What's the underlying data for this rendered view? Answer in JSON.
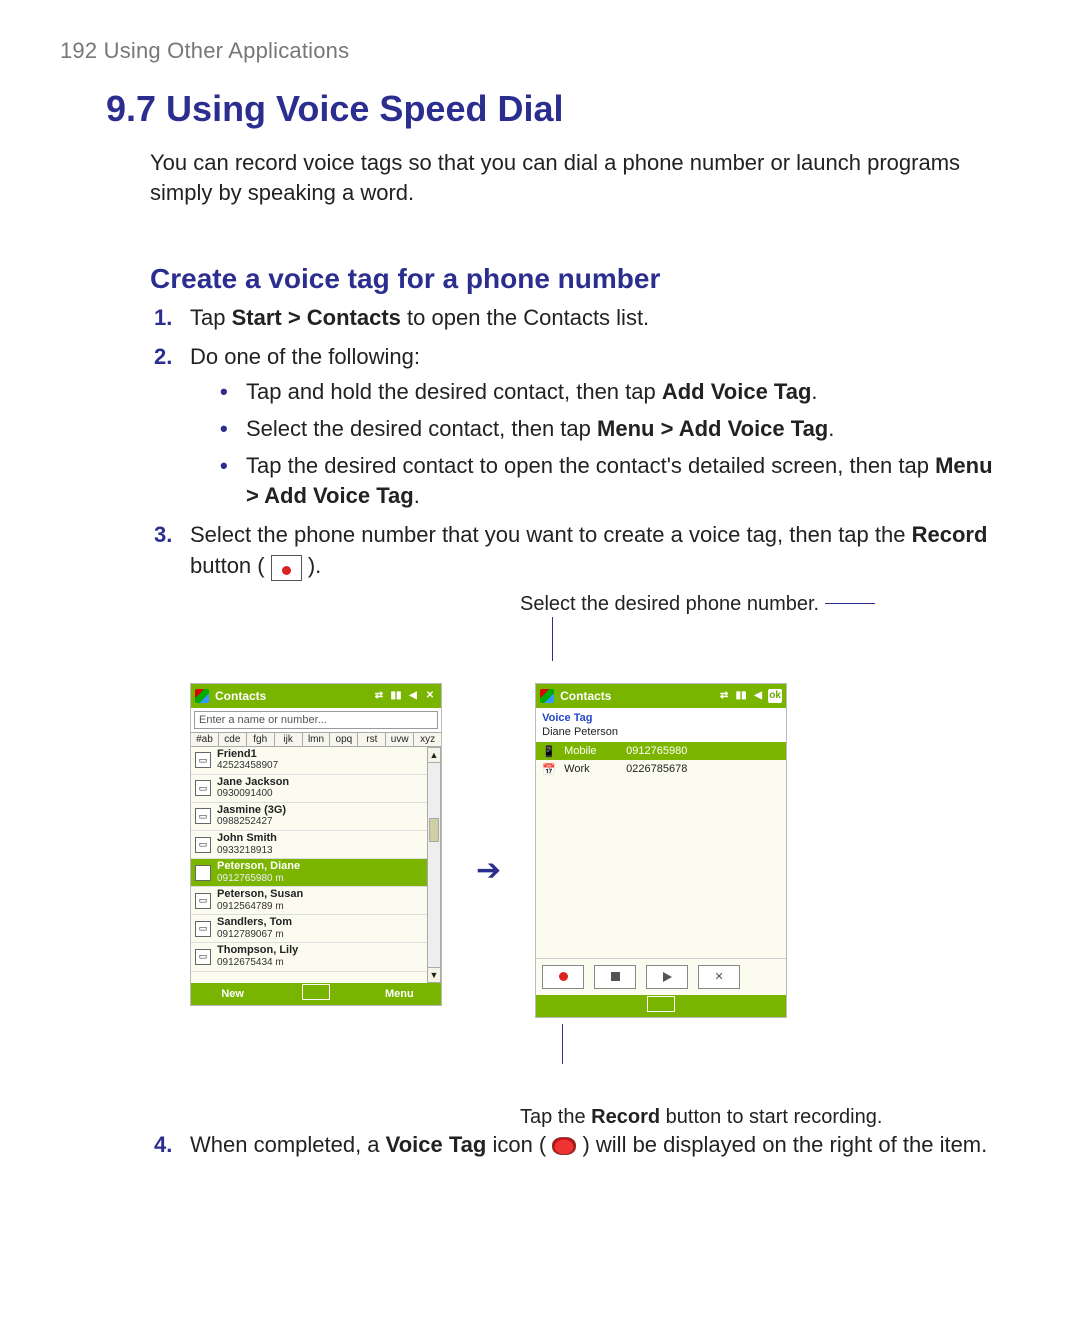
{
  "runhead": "192  Using Other Applications",
  "h1": "9.7 Using Voice Speed Dial",
  "intro": "You can record voice tags so that you can dial a phone number or launch programs simply by speaking a word.",
  "h2": "Create a voice tag for a phone number",
  "steps": {
    "s1_a": "Tap ",
    "s1_b": "Start > Contacts",
    "s1_c": " to open the Contacts list.",
    "s2": "Do one of the following:",
    "b1_a": "Tap and hold the desired contact, then tap ",
    "b1_b": "Add Voice Tag",
    "b1_c": ".",
    "b2_a": "Select the desired contact, then tap ",
    "b2_b": "Menu > Add Voice Tag",
    "b2_c": ".",
    "b3_a": "Tap the desired contact to open the contact's detailed screen, then tap ",
    "b3_b": "Menu > Add Voice Tag",
    "b3_c": ".",
    "s3_a": "Select the phone number that you want to create a voice tag, then tap the ",
    "s3_b": "Record",
    "s3_c": " button ( ",
    "s3_d": " ).",
    "s4_a": "When completed, a ",
    "s4_b": "Voice Tag",
    "s4_c": " icon ( ",
    "s4_d": " ) will be displayed on the right of the item."
  },
  "callouts": {
    "above": "Select the desired phone number.",
    "below_a": "Tap the ",
    "below_b": "Record",
    "below_c": " button to start recording."
  },
  "device1": {
    "title": "Contacts",
    "ok": "✕",
    "search_placeholder": "Enter a name or number...",
    "tabs": [
      "#ab",
      "cde",
      "fgh",
      "ijk",
      "lmn",
      "opq",
      "rst",
      "uvw",
      "xyz"
    ],
    "contacts": [
      {
        "name": "Friend1",
        "phone": "42523458907",
        "sel": false
      },
      {
        "name": "Jane Jackson",
        "phone": "0930091400",
        "sel": false
      },
      {
        "name": "Jasmine (3G)",
        "phone": "0988252427",
        "sel": false
      },
      {
        "name": "John Smith",
        "phone": "0933218913",
        "sel": false
      },
      {
        "name": "Peterson, Diane",
        "phone": "0912765980  m",
        "sel": true
      },
      {
        "name": "Peterson, Susan",
        "phone": "0912564789  m",
        "sel": false
      },
      {
        "name": "Sandlers, Tom",
        "phone": "0912789067  m",
        "sel": false
      },
      {
        "name": "Thompson, Lily",
        "phone": "0912675434  m",
        "sel": false
      }
    ],
    "soft_left": "New",
    "soft_right": "Menu"
  },
  "device2": {
    "title": "Contacts",
    "ok": "ok",
    "subtitle": "Voice Tag",
    "contact": "Diane Peterson",
    "numbers": [
      {
        "label": "Mobile",
        "value": "0912765980",
        "sel": true
      },
      {
        "label": "Work",
        "value": "0226785678",
        "sel": false
      }
    ]
  },
  "nums": {
    "n1": "1.",
    "n2": "2.",
    "n3": "3.",
    "n4": "4."
  }
}
